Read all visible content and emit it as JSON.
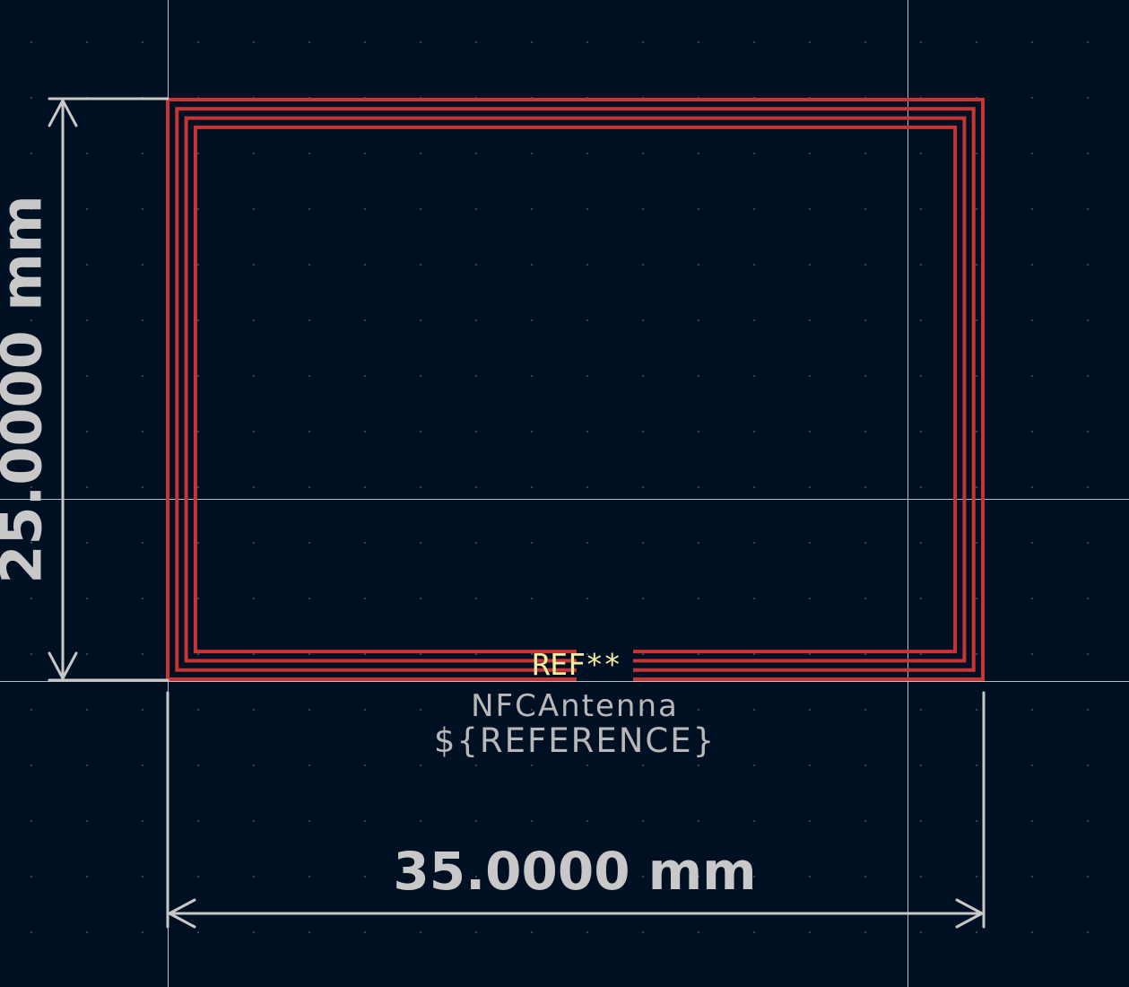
{
  "view": {
    "background_color": "#001023",
    "grid_dot_color": "#34465a",
    "crosshair_color": "#c8d0dc"
  },
  "footprint": {
    "reference": "REF**",
    "value": "NFCAntenna",
    "fab_text": "${REFERENCE}",
    "coil_turns": 4,
    "coil_color": "#c83434",
    "silk_color": "#f2eda1",
    "fab_color": "#b8b8b8"
  },
  "dimensions": {
    "width_text": "35.0000 mm",
    "height_text": "25.0000 mm",
    "color": "#c8c8c8"
  }
}
